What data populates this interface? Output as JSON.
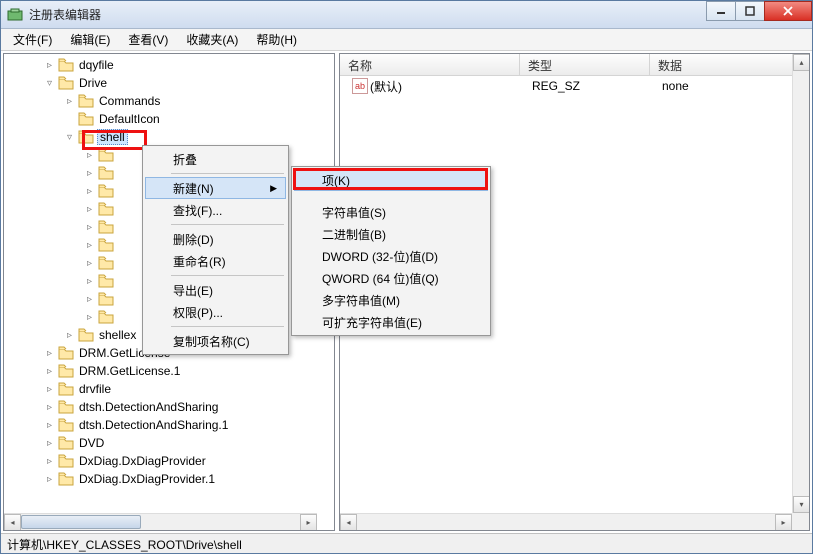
{
  "window": {
    "title": "注册表编辑器"
  },
  "menubar": [
    "文件(F)",
    "编辑(E)",
    "查看(V)",
    "收藏夹(A)",
    "帮助(H)"
  ],
  "list": {
    "headers": {
      "name": "名称",
      "type": "类型",
      "data": "数据"
    },
    "rows": [
      {
        "name": "(默认)",
        "type": "REG_SZ",
        "data": "none"
      }
    ]
  },
  "tree": {
    "nodes": [
      {
        "indent": 40,
        "exp": "▹",
        "label": "dqyfile"
      },
      {
        "indent": 40,
        "exp": "▿",
        "label": "Drive"
      },
      {
        "indent": 60,
        "exp": "▹",
        "label": "Commands"
      },
      {
        "indent": 60,
        "exp": "",
        "label": "DefaultIcon"
      },
      {
        "indent": 60,
        "exp": "▿",
        "label": "shell",
        "selected": true
      },
      {
        "indent": 80,
        "exp": "▹",
        "label": ""
      },
      {
        "indent": 80,
        "exp": "▹",
        "label": ""
      },
      {
        "indent": 80,
        "exp": "▹",
        "label": ""
      },
      {
        "indent": 80,
        "exp": "▹",
        "label": ""
      },
      {
        "indent": 80,
        "exp": "▹",
        "label": ""
      },
      {
        "indent": 80,
        "exp": "▹",
        "label": ""
      },
      {
        "indent": 80,
        "exp": "▹",
        "label": ""
      },
      {
        "indent": 80,
        "exp": "▹",
        "label": ""
      },
      {
        "indent": 80,
        "exp": "▹",
        "label": ""
      },
      {
        "indent": 80,
        "exp": "▹",
        "label": ""
      },
      {
        "indent": 60,
        "exp": "▹",
        "label": "shellex"
      },
      {
        "indent": 40,
        "exp": "▹",
        "label": "DRM.GetLicense"
      },
      {
        "indent": 40,
        "exp": "▹",
        "label": "DRM.GetLicense.1"
      },
      {
        "indent": 40,
        "exp": "▹",
        "label": "drvfile"
      },
      {
        "indent": 40,
        "exp": "▹",
        "label": "dtsh.DetectionAndSharing"
      },
      {
        "indent": 40,
        "exp": "▹",
        "label": "dtsh.DetectionAndSharing.1"
      },
      {
        "indent": 40,
        "exp": "▹",
        "label": "DVD"
      },
      {
        "indent": 40,
        "exp": "▹",
        "label": "DxDiag.DxDiagProvider"
      },
      {
        "indent": 40,
        "exp": "▹",
        "label": "DxDiag.DxDiagProvider.1"
      }
    ]
  },
  "ctx1": {
    "items": [
      {
        "label": "折叠"
      },
      {
        "sep": true
      },
      {
        "label": "新建(N)",
        "hover": true,
        "arrow": true
      },
      {
        "label": "查找(F)..."
      },
      {
        "sep": true
      },
      {
        "label": "删除(D)"
      },
      {
        "label": "重命名(R)"
      },
      {
        "sep": true
      },
      {
        "label": "导出(E)"
      },
      {
        "label": "权限(P)..."
      },
      {
        "sep": true
      },
      {
        "label": "复制项名称(C)"
      }
    ]
  },
  "ctx2": {
    "items": [
      {
        "label": "项(K)",
        "hover": true
      },
      {
        "sep_blank": true
      },
      {
        "label": "字符串值(S)"
      },
      {
        "label": "二进制值(B)"
      },
      {
        "label": "DWORD (32-位)值(D)"
      },
      {
        "label": "QWORD (64 位)值(Q)"
      },
      {
        "label": "多字符串值(M)"
      },
      {
        "label": "可扩充字符串值(E)"
      }
    ]
  },
  "status": "计算机\\HKEY_CLASSES_ROOT\\Drive\\shell"
}
